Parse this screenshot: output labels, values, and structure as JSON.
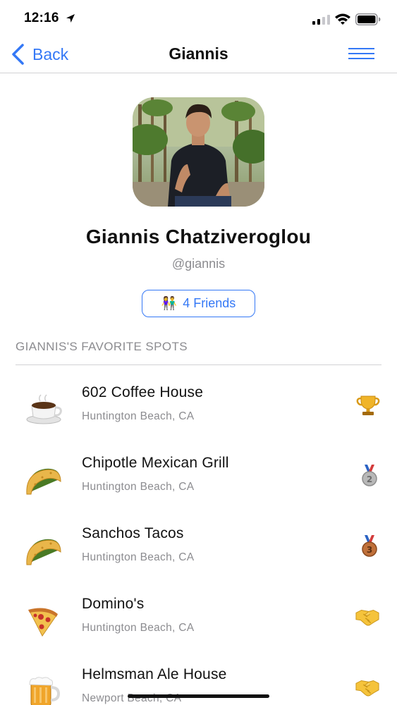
{
  "status_bar": {
    "time": "12:16",
    "icons": [
      "location-arrow-icon",
      "signal-icon",
      "wifi-icon",
      "battery-icon"
    ]
  },
  "nav": {
    "back_label": "Back",
    "title": "Giannis",
    "menu_icon": "hamburger-menu-icon",
    "accent_color": "#3478f6"
  },
  "profile": {
    "name": "Giannis Chatziveroglou",
    "handle": "@giannis",
    "friends_emoji": "👫",
    "friends_label": "4 Friends"
  },
  "favorites": {
    "header": "GIANNIS'S FAVORITE SPOTS",
    "items": [
      {
        "name": "602 Coffee House",
        "location": "Huntington Beach, CA",
        "icon": "coffee-cup-icon",
        "badge": "trophy-icon"
      },
      {
        "name": "Chipotle Mexican Grill",
        "location": "Huntington Beach, CA",
        "icon": "taco-icon",
        "badge": "second-place-medal-icon"
      },
      {
        "name": "Sanchos Tacos",
        "location": "Huntington Beach, CA",
        "icon": "taco-icon",
        "badge": "third-place-medal-icon"
      },
      {
        "name": "Domino's",
        "location": "Huntington Beach, CA",
        "icon": "pizza-slice-icon",
        "badge": "handshake-icon"
      },
      {
        "name": "Helmsman Ale House",
        "location": "Newport Beach, CA",
        "icon": "beer-mug-icon",
        "badge": "handshake-icon"
      }
    ]
  }
}
